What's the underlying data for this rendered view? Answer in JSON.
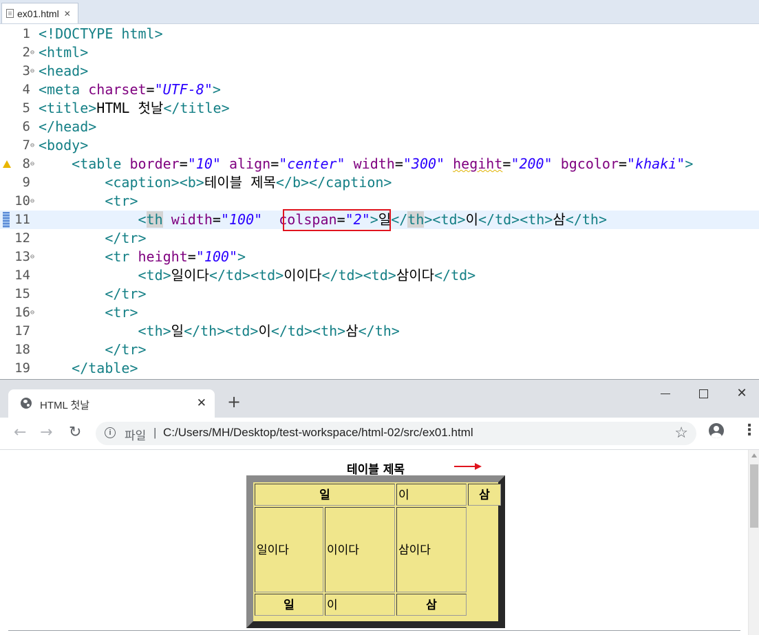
{
  "editor": {
    "tab": {
      "filename": "ex01.html",
      "close": "✕"
    },
    "lines": [
      {
        "n": "1",
        "fold": "",
        "marker": "",
        "current": false,
        "tokens": [
          [
            "t",
            "<!DOCTYPE html>"
          ]
        ]
      },
      {
        "n": "2",
        "fold": "⊖",
        "marker": "",
        "current": false,
        "tokens": [
          [
            "t",
            "<html>"
          ]
        ]
      },
      {
        "n": "3",
        "fold": "⊖",
        "marker": "",
        "current": false,
        "tokens": [
          [
            "t",
            "<head>"
          ]
        ]
      },
      {
        "n": "4",
        "fold": "",
        "marker": "",
        "current": false,
        "tokens": [
          [
            "t",
            "<meta "
          ],
          [
            "a",
            "charset"
          ],
          [
            "x",
            "="
          ],
          [
            "v",
            "\"UTF-8\""
          ],
          [
            "t",
            ">"
          ]
        ]
      },
      {
        "n": "5",
        "fold": "",
        "marker": "",
        "current": false,
        "tokens": [
          [
            "t",
            "<title>"
          ],
          [
            "x",
            "HTML 첫날"
          ],
          [
            "t",
            "</title>"
          ]
        ]
      },
      {
        "n": "6",
        "fold": "",
        "marker": "",
        "current": false,
        "tokens": [
          [
            "t",
            "</head>"
          ]
        ]
      },
      {
        "n": "7",
        "fold": "⊖",
        "marker": "",
        "current": false,
        "tokens": [
          [
            "t",
            "<body>"
          ]
        ]
      },
      {
        "n": "8",
        "fold": "⊖",
        "marker": "warning",
        "current": false,
        "tokens": [
          [
            "t",
            "    <table "
          ],
          [
            "a",
            "border"
          ],
          [
            "x",
            "="
          ],
          [
            "v",
            "\"10\""
          ],
          [
            "x",
            " "
          ],
          [
            "a",
            "align"
          ],
          [
            "x",
            "="
          ],
          [
            "v",
            "\"center\""
          ],
          [
            "x",
            " "
          ],
          [
            "a",
            "width"
          ],
          [
            "x",
            "="
          ],
          [
            "v",
            "\"300\""
          ],
          [
            "x",
            " "
          ],
          [
            "a sq",
            "hegiht"
          ],
          [
            "x",
            "="
          ],
          [
            "v",
            "\"200\""
          ],
          [
            "x",
            " "
          ],
          [
            "a",
            "bgcolor"
          ],
          [
            "x",
            "="
          ],
          [
            "v",
            "\"khaki\""
          ],
          [
            "t",
            ">"
          ]
        ]
      },
      {
        "n": "9",
        "fold": "",
        "marker": "",
        "current": false,
        "tokens": [
          [
            "t",
            "        <caption><b>"
          ],
          [
            "x",
            "테이블 제목"
          ],
          [
            "t",
            "</b></caption>"
          ]
        ]
      },
      {
        "n": "10",
        "fold": "⊖",
        "marker": "",
        "current": false,
        "tokens": [
          [
            "t",
            "        <tr>"
          ]
        ]
      },
      {
        "n": "11",
        "fold": "",
        "marker": "current",
        "current": true,
        "tokens": [
          [
            "t",
            "            <"
          ],
          [
            "t hl",
            "th"
          ],
          [
            "x",
            " "
          ],
          [
            "a",
            "width"
          ],
          [
            "x",
            "="
          ],
          [
            "v",
            "\"100\""
          ],
          [
            "x",
            "  "
          ],
          [
            "a",
            "colspan"
          ],
          [
            "x",
            "="
          ],
          [
            "v",
            "\"2\""
          ],
          [
            "t",
            ">"
          ],
          [
            "x",
            "일"
          ],
          [
            "t",
            "</"
          ],
          [
            "t hl",
            "th"
          ],
          [
            "t",
            "><td>"
          ],
          [
            "x",
            "이"
          ],
          [
            "t",
            "</td><th>"
          ],
          [
            "x",
            "삼"
          ],
          [
            "t",
            "</th>"
          ]
        ]
      },
      {
        "n": "12",
        "fold": "",
        "marker": "",
        "current": false,
        "tokens": [
          [
            "t",
            "        </tr>"
          ]
        ]
      },
      {
        "n": "13",
        "fold": "⊖",
        "marker": "",
        "current": false,
        "tokens": [
          [
            "t",
            "        <tr "
          ],
          [
            "a",
            "height"
          ],
          [
            "x",
            "="
          ],
          [
            "v",
            "\"100\""
          ],
          [
            "t",
            ">"
          ]
        ]
      },
      {
        "n": "14",
        "fold": "",
        "marker": "",
        "current": false,
        "tokens": [
          [
            "t",
            "            <td>"
          ],
          [
            "x",
            "일이다"
          ],
          [
            "t",
            "</td><td>"
          ],
          [
            "x",
            "이이다"
          ],
          [
            "t",
            "</td><td>"
          ],
          [
            "x",
            "삼이다"
          ],
          [
            "t",
            "</td>"
          ]
        ]
      },
      {
        "n": "15",
        "fold": "",
        "marker": "",
        "current": false,
        "tokens": [
          [
            "t",
            "        </tr>"
          ]
        ]
      },
      {
        "n": "16",
        "fold": "⊖",
        "marker": "",
        "current": false,
        "tokens": [
          [
            "t",
            "        <tr>"
          ]
        ]
      },
      {
        "n": "17",
        "fold": "",
        "marker": "",
        "current": false,
        "tokens": [
          [
            "t",
            "            <th>"
          ],
          [
            "x",
            "일"
          ],
          [
            "t",
            "</th><td>"
          ],
          [
            "x",
            "이"
          ],
          [
            "t",
            "</td><th>"
          ],
          [
            "x",
            "삼"
          ],
          [
            "t",
            "</th>"
          ]
        ]
      },
      {
        "n": "18",
        "fold": "",
        "marker": "",
        "current": false,
        "tokens": [
          [
            "t",
            "        </tr>"
          ]
        ]
      },
      {
        "n": "19",
        "fold": "",
        "marker": "",
        "current": false,
        "tokens": [
          [
            "t",
            "    </table>"
          ]
        ]
      }
    ],
    "highlight_color": "#e0141e"
  },
  "browser": {
    "tab_title": "HTML 첫날",
    "tab_close": "✕",
    "new_tab": "+",
    "window": {
      "minimize": "",
      "maximize": "",
      "close": "✕"
    },
    "nav": {
      "back": "←",
      "forward": "→",
      "reload": "↻"
    },
    "omnibox": {
      "info": "i",
      "scheme_label": "파일",
      "separator": "|",
      "url": "C:/Users/MH/Desktop/test-workspace/html-02/src/ex01.html",
      "star": "☆"
    },
    "menu": "⋮"
  },
  "page": {
    "caption": "테이블 제목",
    "table_bg": "khaki",
    "rows": [
      [
        {
          "text": "일",
          "th": true
        },
        {
          "text": "이",
          "th": false
        },
        {
          "text": "삼",
          "th": true
        }
      ],
      [
        {
          "text": "일이다",
          "th": false
        },
        {
          "text": "이이다",
          "th": false
        },
        {
          "text": "삼이다",
          "th": false
        }
      ],
      [
        {
          "text": "일",
          "th": true
        },
        {
          "text": "이",
          "th": false
        },
        {
          "text": "삼",
          "th": true
        }
      ]
    ]
  }
}
